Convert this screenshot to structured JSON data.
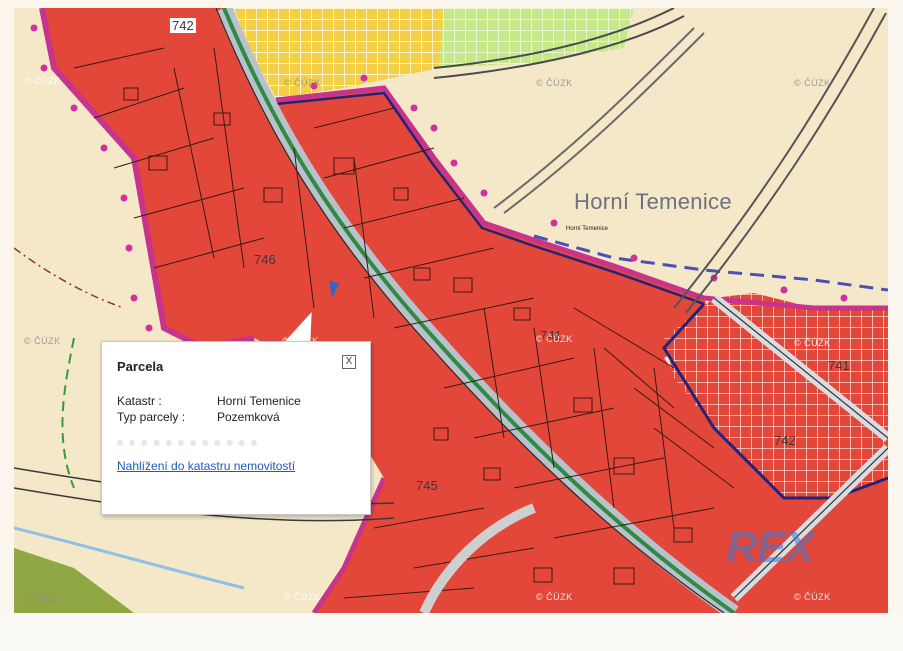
{
  "map": {
    "village_label": "Horní Temenice",
    "village_small_label": "Horní Temenice",
    "watermark": "© ČÚZK",
    "brand_watermark": "REX",
    "parcel_numbers": [
      "742",
      "746",
      "741",
      "742",
      "741",
      "745"
    ],
    "colors": {
      "background": "#f4e8c8",
      "built_area": "#e2473a",
      "checkered_area": "#f5d9d4",
      "yellow_area": "#f3d046",
      "green_area": "#c7e88a",
      "boundary_magenta": "#c8348c",
      "boundary_navy": "#23237a",
      "road_grey": "#b9c2ca",
      "road_green": "#2f8a45",
      "dashed_blue": "#4b4fb8"
    }
  },
  "popup": {
    "title": "Parcela",
    "close_symbol": "X",
    "rows": [
      {
        "label": "Katastr :",
        "value": "Horní Temenice"
      },
      {
        "label": "Typ parcely :",
        "value": "Pozemková"
      }
    ],
    "link": "Nahlížení do katastru nemovitostí"
  }
}
